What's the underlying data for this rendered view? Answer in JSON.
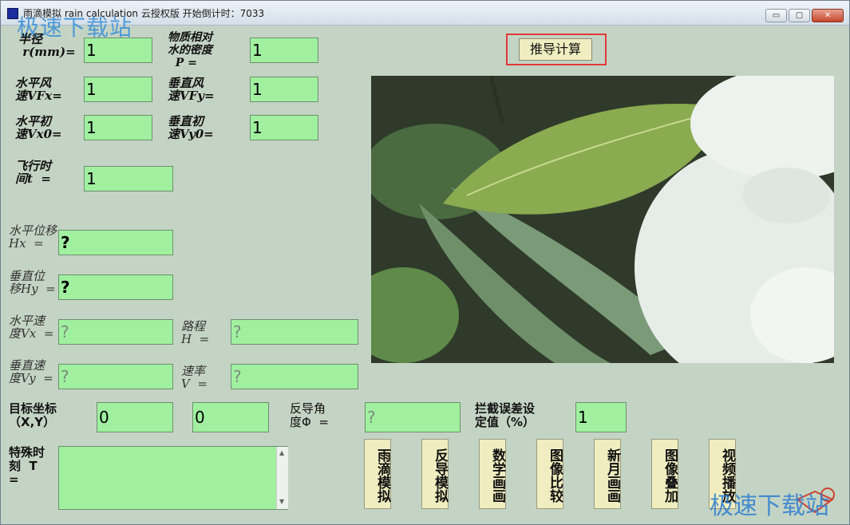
{
  "window": {
    "title": "雨滴模拟 rain calculation 云授权版   开始倒计时：7033",
    "minimize": "▭",
    "maximize": "▢",
    "close": "✕"
  },
  "watermark": {
    "top": "极速下载站",
    "bottom": "极速下载站"
  },
  "inputs": {
    "radius": {
      "label": "半径\n r(mm)=",
      "value": "1"
    },
    "density": {
      "label": "物质相对\n水的密度\n  P =",
      "value": "1"
    },
    "wind_h": {
      "label": "水平风\n速VFx=",
      "value": "1"
    },
    "wind_v": {
      "label": "垂直风\n速VFy=",
      "value": "1"
    },
    "v0_h": {
      "label": "水平初\n速Vx0=",
      "value": "1"
    },
    "v0_v": {
      "label": "垂直初\n速Vy0=",
      "value": "1"
    },
    "flight_time": {
      "label": "飞行时\n间t  =",
      "value": "1"
    }
  },
  "outputs": {
    "hx": {
      "label": "水平位移\nHx  =",
      "value": "?"
    },
    "hy": {
      "label": "垂直位\n移Hy  =",
      "value": "?"
    },
    "vx": {
      "label": "水平速\n度Vx  =",
      "value": "?"
    },
    "vy": {
      "label": "垂直速\n度Vy  =",
      "value": "?"
    },
    "distance": {
      "label": "路程\nH  =",
      "value": "?"
    },
    "speed": {
      "label": "速率\nV  =",
      "value": "?"
    }
  },
  "target": {
    "label": "目标坐标\n（X,Y）",
    "x": "0",
    "y": "0"
  },
  "reverse_angle": {
    "label": "反导角\n度Φ  =",
    "value": "?"
  },
  "intercept": {
    "label": "拦截误差设\n定值（%）",
    "value": "1"
  },
  "special": {
    "label": "特殊时\n刻  T\n=",
    "value": ""
  },
  "calc_button": "推导计算",
  "bottom_buttons": [
    "雨滴模拟",
    "反导模拟",
    "数学画画",
    "图像比较",
    "新月画画",
    "图像叠加",
    "视频播放"
  ],
  "colors": {
    "window_bg": "#c4d4c4",
    "field_bg": "#a0f0a0",
    "button_bg": "#f0eec0",
    "highlight": "#e23838"
  }
}
